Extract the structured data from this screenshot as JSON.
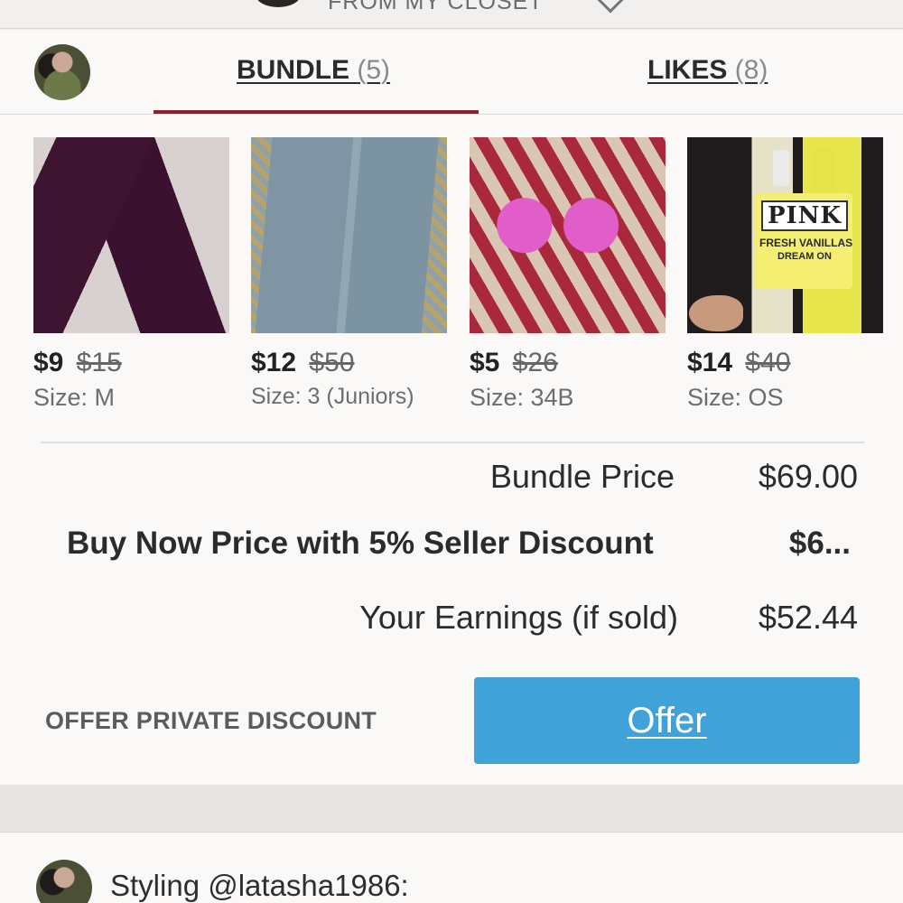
{
  "header": {
    "title": "FROM MY CLOSET",
    "chevron_icon": "chevron-down-icon"
  },
  "tabs": [
    {
      "label": "BUNDLE",
      "count": "(5)",
      "active": true
    },
    {
      "label": "LIKES",
      "count": "(8)",
      "active": false
    }
  ],
  "colors": {
    "accent": "#8e1f2c",
    "offer_button": "#3fa3da"
  },
  "items": [
    {
      "price": "$9",
      "original_price": "$15",
      "size": "Size: M",
      "image": "purple leggings"
    },
    {
      "price": "$12",
      "original_price": "$50",
      "size": "Size: 3 (Juniors)",
      "image": "acid wash jeans"
    },
    {
      "price": "$5",
      "original_price": "$26",
      "size": "Size: 34B",
      "image": "pink lace bra"
    },
    {
      "price": "$14",
      "original_price": "$40",
      "size": "Size: OS",
      "image": "body lotion bottles"
    }
  ],
  "item4_label": {
    "brand": "PINK",
    "line1": "FRESH VANILLAS",
    "line2": "DREAM ON"
  },
  "summary": {
    "bundle_price_label": "Bundle Price",
    "bundle_price_value": "$69.00",
    "buy_now_label": "Buy Now Price with 5% Seller Discount",
    "buy_now_value": "$6...",
    "earnings_label": "Your Earnings (if sold)",
    "earnings_value": "$52.44"
  },
  "actions": {
    "private_discount_label": "OFFER PRIVATE DISCOUNT",
    "offer_label": "Offer"
  },
  "comment": {
    "text": "Styling @latasha1986:"
  }
}
